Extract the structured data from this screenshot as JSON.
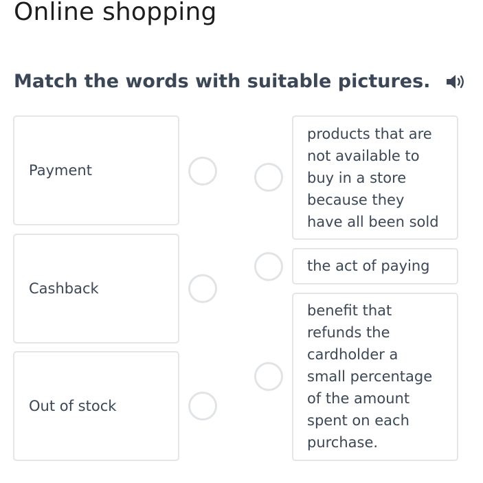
{
  "page": {
    "title": "Online shopping"
  },
  "exercise": {
    "instruction": "Match the words with suitable pictures.",
    "audio_icon": "speaker-icon"
  },
  "words": [
    {
      "label": "Payment"
    },
    {
      "label": "Cashback"
    },
    {
      "label": "Out of stock"
    }
  ],
  "definitions": [
    {
      "lines": [
        "products that are",
        "not available to",
        "buy in a store",
        "because they",
        "have all been sold"
      ]
    },
    {
      "lines": [
        "the act of paying"
      ]
    },
    {
      "lines": [
        "benefit that",
        "refunds the",
        "cardholder a",
        "small percentage",
        "of the amount",
        "spent on each",
        "purchase."
      ]
    }
  ],
  "colors": {
    "heading_text": "#3b4756",
    "title_text": "#1d1d1d",
    "card_border": "#e3e6e9",
    "radio_border": "#e1e4e7"
  }
}
